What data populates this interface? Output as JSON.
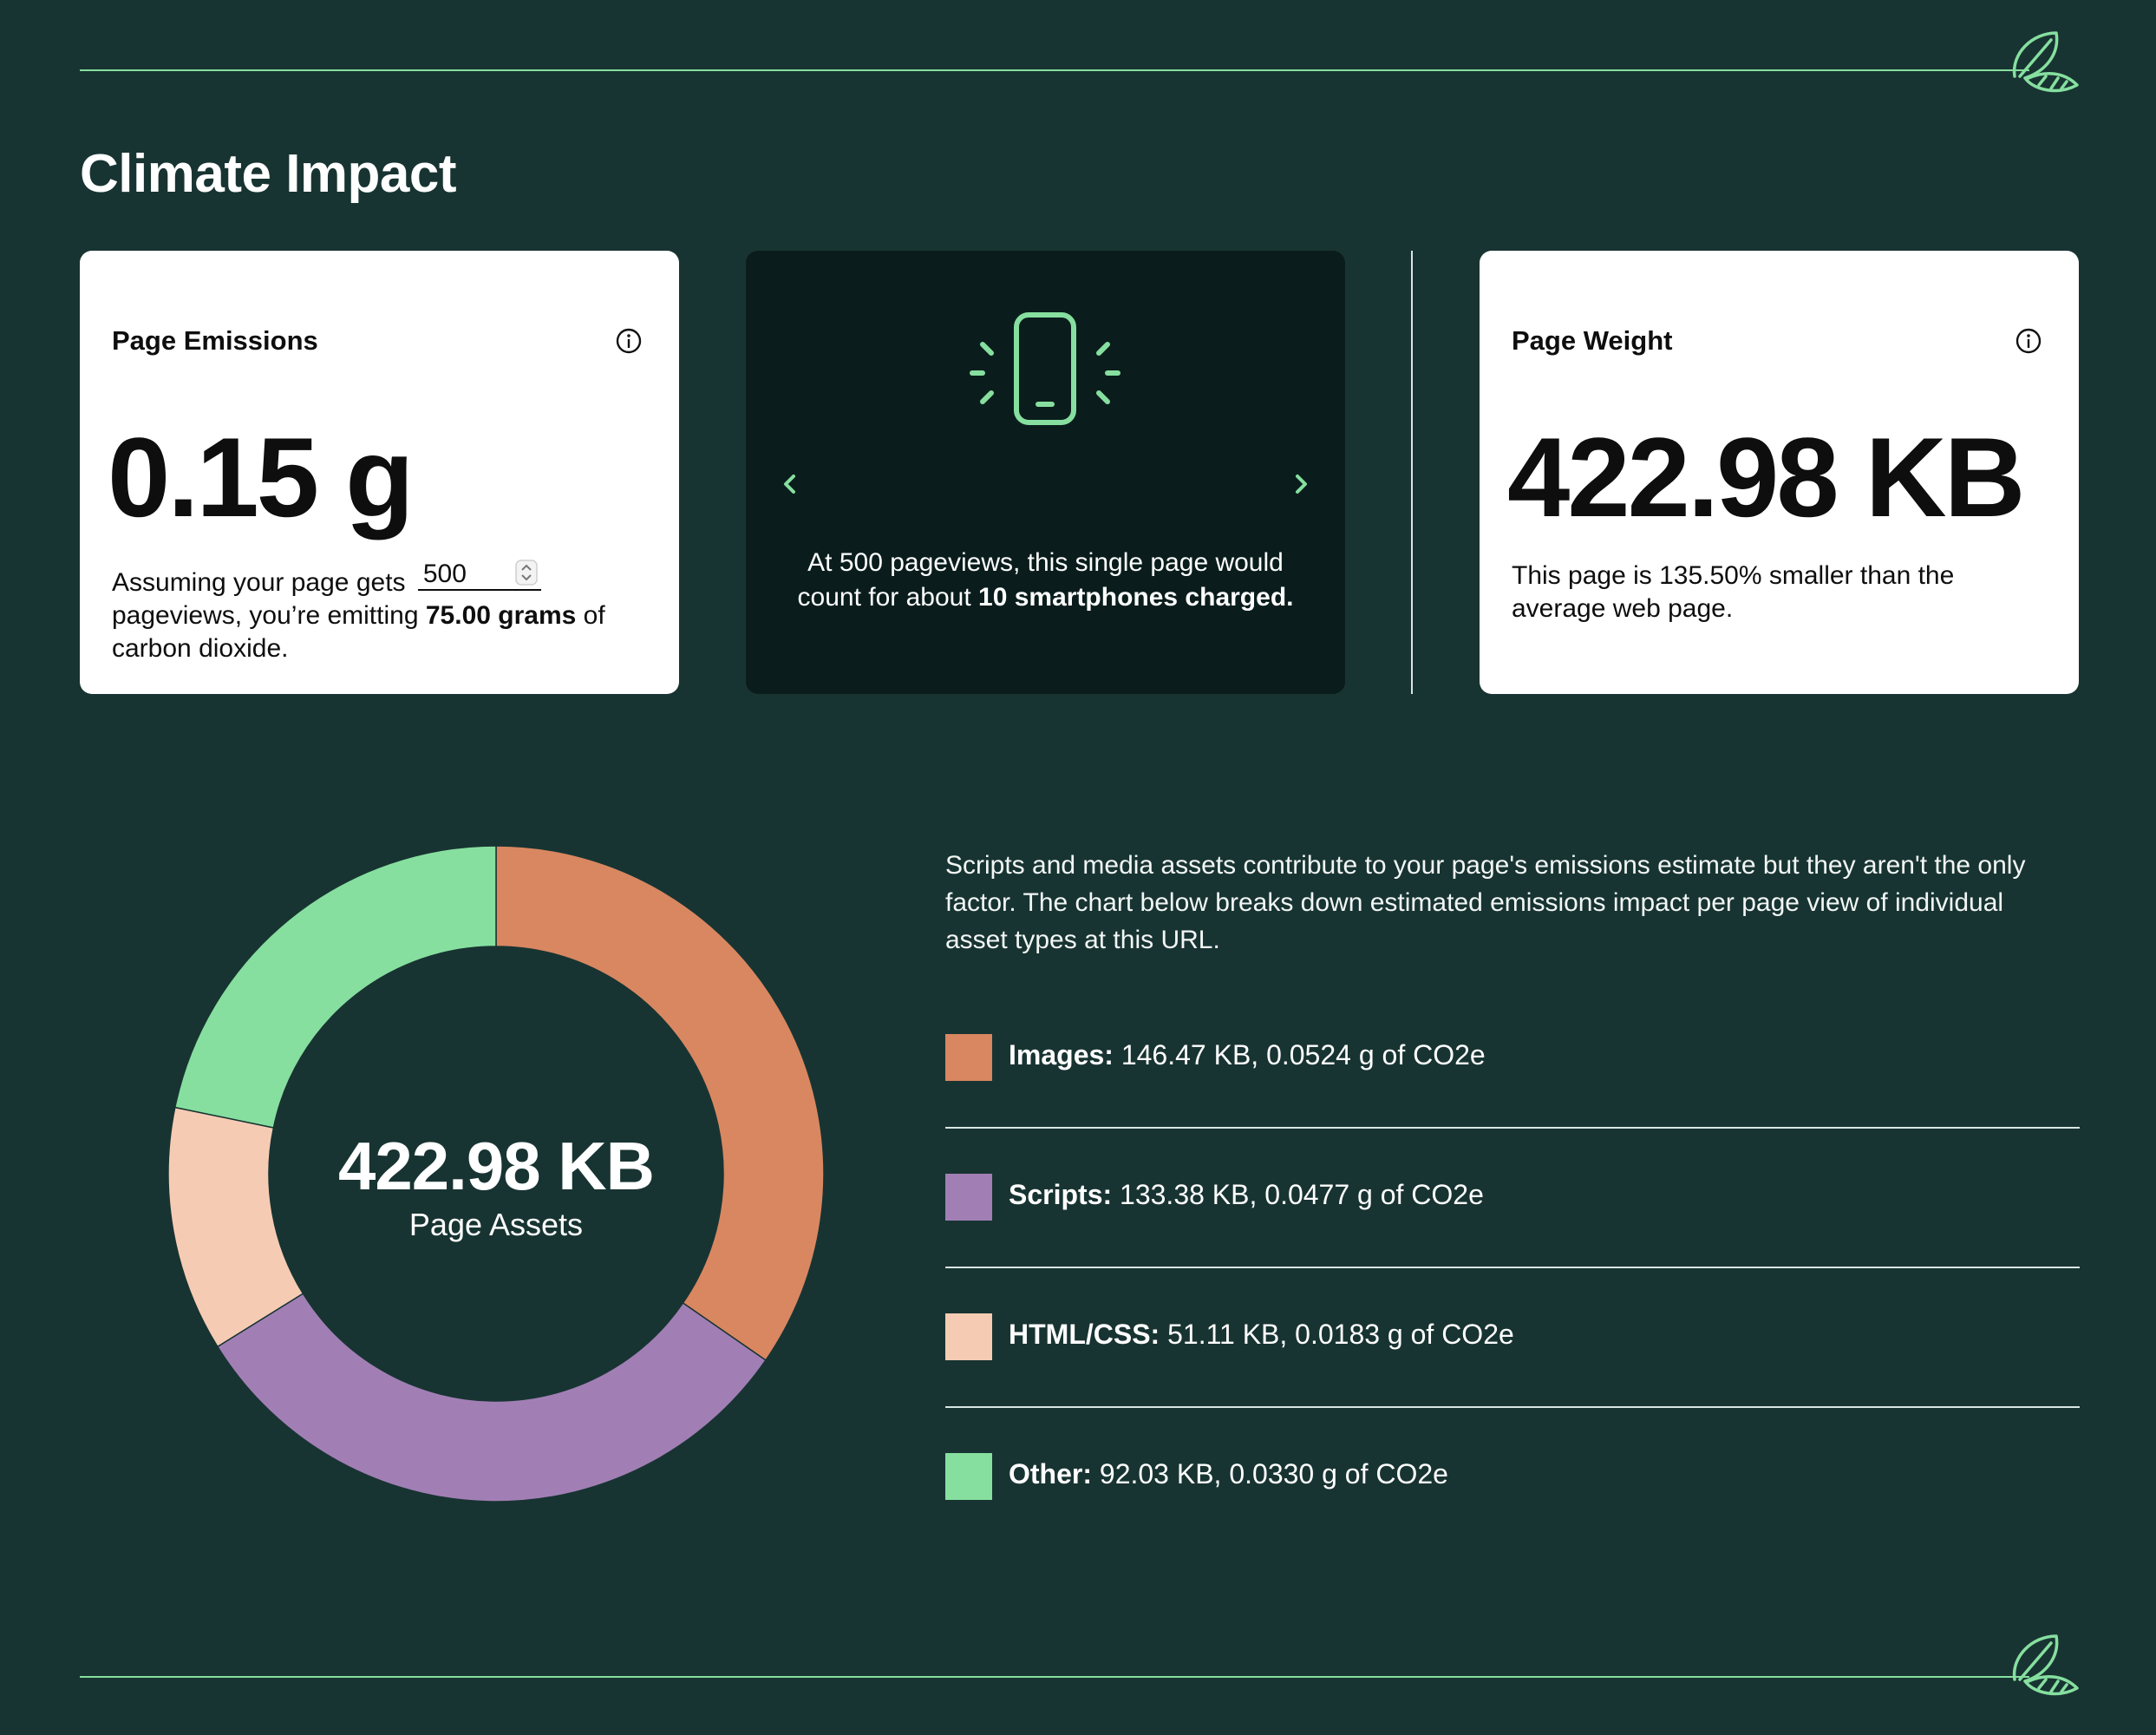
{
  "page": {
    "title": "Climate Impact"
  },
  "emissions": {
    "label": "Page Emissions",
    "value": "0.15 g",
    "text_before": "Assuming your page gets",
    "pageviews": "500",
    "text_middle": "pageviews, you’re emitting",
    "grams": "75.00 grams",
    "text_after": "of carbon dioxide."
  },
  "equivalence": {
    "text_before": "At 500 pageviews, this single page would count for about",
    "highlight": "10 smartphones charged."
  },
  "weight": {
    "label": "Page Weight",
    "value": "422.98 KB",
    "description": "This page is 135.50% smaller than the average web page."
  },
  "assets": {
    "description": "Scripts and media assets contribute to your page's emissions estimate but they aren't the only factor. The chart below breaks down estimated emissions impact per page view of individual asset types at this URL."
  },
  "chart_data": {
    "type": "pie",
    "center_value": "422.98 KB",
    "center_label": "Page Assets",
    "categories": [
      "Images",
      "Scripts",
      "HTML/CSS",
      "Other"
    ],
    "values": [
      146.47,
      133.38,
      51.11,
      92.03
    ],
    "unit": "KB",
    "legend": [
      {
        "label": "Images:",
        "detail": "146.47 KB, 0.0524 g of CO2e",
        "color": "#d98761"
      },
      {
        "label": "Scripts:",
        "detail": "133.38 KB, 0.0477 g of CO2e",
        "color": "#a17fb5"
      },
      {
        "label": "HTML/CSS:",
        "detail": "51.11 KB, 0.0183 g of CO2e",
        "color": "#f6cbb4"
      },
      {
        "label": "Other:",
        "detail": "92.03 KB, 0.0330 g of CO2e",
        "color": "#86df9f"
      }
    ]
  },
  "theme": {
    "accent": "#86df9f",
    "background": "#183432",
    "card_dark": "#0a1d1c"
  },
  "icons": [
    "leaf-logo-icon",
    "info-icon",
    "smartphone-icon",
    "chevron-left-icon",
    "chevron-right-icon",
    "stepper-icon"
  ]
}
